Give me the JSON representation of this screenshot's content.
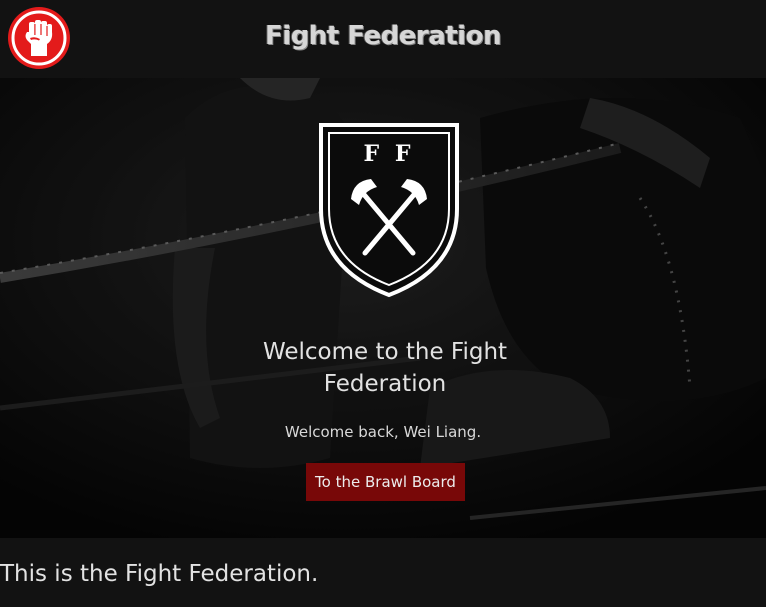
{
  "header": {
    "brand_title": "Fight Federation",
    "logo_icon": "raised-fist-icon",
    "logo_color": "#e31b1b"
  },
  "hero": {
    "crest_icon": "ff-crest-crossed-axes-icon",
    "crest_letters": "F F",
    "title": "Welcome to the Fight Federation",
    "welcome_message": "Welcome back, Wei Liang.",
    "cta_label": "To the Brawl Board",
    "cta_color": "#780808"
  },
  "main": {
    "tagline": "This is the Fight Federation."
  }
}
